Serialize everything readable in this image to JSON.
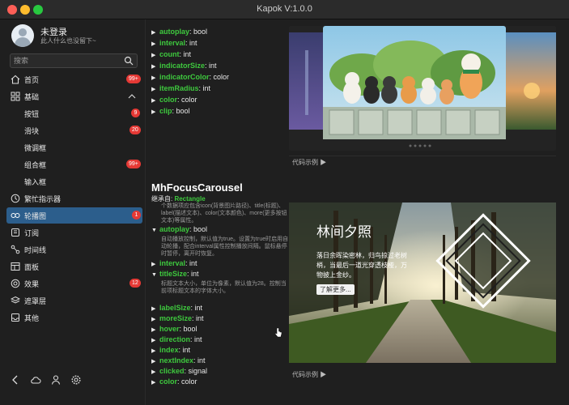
{
  "window": {
    "title": "Kapok V:1.0.0"
  },
  "user": {
    "name": "未登录",
    "subtitle": "此人什么也没留下~"
  },
  "search": {
    "placeholder": "搜索"
  },
  "nav": {
    "home": {
      "label": "首页",
      "badge": "99+"
    },
    "basic": {
      "label": "基础"
    },
    "button": {
      "label": "按钮",
      "badge": "9"
    },
    "slider": {
      "label": "滑块",
      "badge": "20"
    },
    "spinbox": {
      "label": "微调框"
    },
    "combobox": {
      "label": "组合框",
      "badge": "99+"
    },
    "input": {
      "label": "输入框"
    },
    "busy": {
      "label": "繁忙指示器"
    },
    "carousel": {
      "label": "轮播图",
      "badge": "1"
    },
    "subscribe": {
      "label": "订阅"
    },
    "timeline": {
      "label": "时间线"
    },
    "panel": {
      "label": "面板"
    },
    "effects": {
      "label": "效果",
      "badge": "12"
    },
    "mask": {
      "label": "遮罩层"
    },
    "other": {
      "label": "其他"
    }
  },
  "props_top": [
    {
      "key": "autoplay",
      "type": ": bool"
    },
    {
      "key": "interval",
      "type": ": int"
    },
    {
      "key": "count",
      "type": ": int"
    },
    {
      "key": "indicatorSize",
      "type": ": int"
    },
    {
      "key": "indicatorColor",
      "type": ": color"
    },
    {
      "key": "itemRadius",
      "type": ": int"
    },
    {
      "key": "color",
      "type": ": color"
    },
    {
      "key": "clip",
      "type": ": bool"
    }
  ],
  "component": {
    "title": "MhFocusCarousel",
    "inherit_prefix": "继承自: ",
    "inherit_link": "Rectangle",
    "description": "个数据项应包含icon(背景图片路径)、title(标题)、label(描述文本)、color(文本颜色)、more(更多按钮文本)等属性。"
  },
  "props_bottom": [
    {
      "key": "autoplay",
      "type": ": bool",
      "expanded": true,
      "desc": "自动播放控制，默认值为true。设置为true时启用自动轮播，配合interval属性控制播放间隔。鼠标悬停时暂停，离开时恢复。"
    },
    {
      "key": "interval",
      "type": ": int"
    },
    {
      "key": "titleSize",
      "type": ": int",
      "expanded": true,
      "desc": "标题文本大小，单位为像素，默认值为28。控制当前项标题文本的字体大小。"
    },
    {
      "key": "labelSize",
      "type": ": int"
    },
    {
      "key": "moreSize",
      "type": ": int"
    },
    {
      "key": "hover",
      "type": ": bool"
    },
    {
      "key": "direction",
      "type": ": int"
    },
    {
      "key": "index",
      "type": ": int"
    },
    {
      "key": "nextIndex",
      "type": ": int"
    },
    {
      "key": "clicked",
      "type": ": signal"
    },
    {
      "key": "color",
      "type": ": color"
    }
  ],
  "demo": {
    "code_example": "代码示例 ▶",
    "slide_title": "林间夕照",
    "slide_text": "落日余晖染密林，归鸟掠过老树梢，当最后一道光穿透枝桠，万物披上金纱。",
    "more_button": "了解更多..."
  },
  "colors": {
    "accent_green": "#3ec93e",
    "active_nav": "#2c5e8c",
    "badge_red": "#e53935"
  }
}
